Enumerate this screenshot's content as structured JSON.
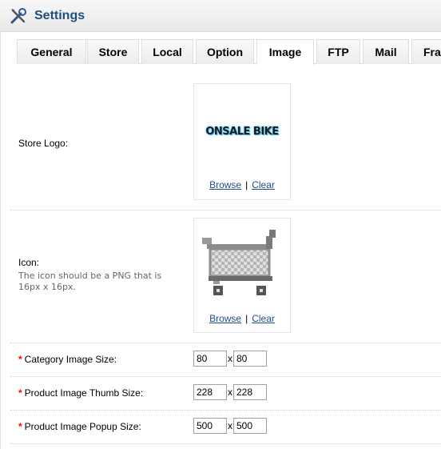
{
  "heading": {
    "title": "Settings",
    "icon": "settings-tools-icon"
  },
  "tabs": [
    {
      "label": "General",
      "active": false
    },
    {
      "label": "Store",
      "active": false
    },
    {
      "label": "Local",
      "active": false
    },
    {
      "label": "Option",
      "active": false
    },
    {
      "label": "Image",
      "active": true
    },
    {
      "label": "FTP",
      "active": false
    },
    {
      "label": "Mail",
      "active": false
    },
    {
      "label": "Fra",
      "active": false
    }
  ],
  "store_logo": {
    "label": "Store Logo:",
    "logo_text": "ONSALE BIKE",
    "browse": "Browse",
    "separator": "|",
    "clear": "Clear"
  },
  "icon": {
    "label": "Icon:",
    "help": "The icon should be a PNG that is 16px x 16px.",
    "image": "shopping-cart-icon",
    "browse": "Browse",
    "separator": "|",
    "clear": "Clear"
  },
  "sizes": {
    "required_mark": "*",
    "separator": "x",
    "category": {
      "label": "Category Image Size:",
      "width": "80",
      "height": "80"
    },
    "thumb": {
      "label": "Product Image Thumb Size:",
      "width": "228",
      "height": "228"
    },
    "popup": {
      "label": "Product Image Popup Size:",
      "width": "500",
      "height": "500"
    }
  }
}
